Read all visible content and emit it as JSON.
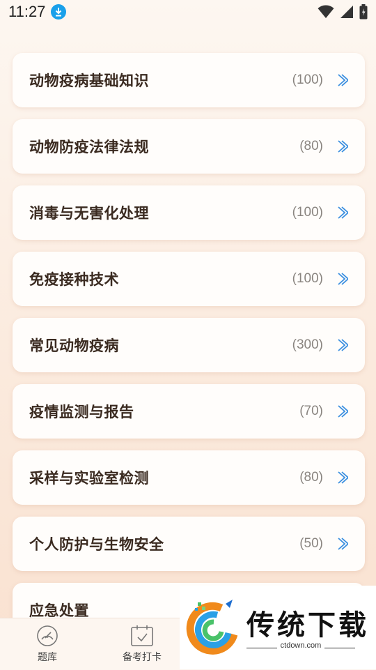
{
  "status": {
    "time": "11:27"
  },
  "categories": [
    {
      "title": "动物疫病基础知识",
      "count": "(100)"
    },
    {
      "title": "动物防疫法律法规",
      "count": "(80)"
    },
    {
      "title": "消毒与无害化处理",
      "count": "(100)"
    },
    {
      "title": "免疫接种技术",
      "count": "(100)"
    },
    {
      "title": "常见动物疫病",
      "count": "(300)"
    },
    {
      "title": "疫情监测与报告",
      "count": "(70)"
    },
    {
      "title": "采样与实验室检测",
      "count": "(80)"
    },
    {
      "title": "个人防护与生物安全",
      "count": "(50)"
    },
    {
      "title": "应急处置",
      "count": ""
    }
  ],
  "tabbar": {
    "tab1": "题库",
    "tab2": "备考打卡"
  },
  "watermark": {
    "brand": "传统下载",
    "url": "ctdown.com"
  },
  "colors": {
    "accent": "#3b8fe0",
    "title": "#3a2a20",
    "count": "#8a8580"
  }
}
